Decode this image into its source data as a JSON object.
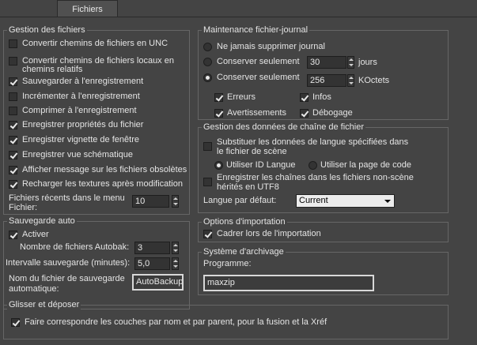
{
  "tab": {
    "label": "Fichiers"
  },
  "gestion": {
    "title": "Gestion des fichiers",
    "items": [
      {
        "label": "Convertir chemins de fichiers en UNC",
        "checked": false
      },
      {
        "label": "Convertir chemins de fichiers locaux en",
        "label2": "chemins relatifs",
        "checked": false
      },
      {
        "label": "Sauvegarder à l'enregistrement",
        "checked": true
      },
      {
        "label": "Incrémenter à l'enregistrement",
        "checked": false
      },
      {
        "label": "Comprimer à l'enregistrement",
        "checked": false
      },
      {
        "label": "Enregistrer propriétés du fichier",
        "checked": true
      },
      {
        "label": "Enregistrer vignette de fenêtre",
        "checked": true
      },
      {
        "label": "Enregistrer vue schématique",
        "checked": true
      },
      {
        "label": "Afficher message sur les fichiers obsolètes",
        "checked": true
      },
      {
        "label": "Recharger les textures après modification",
        "checked": true
      }
    ],
    "recent_label1": "Fichiers récents dans le menu",
    "recent_label2": "Fichier:",
    "recent_value": "10"
  },
  "sauvegarde": {
    "title": "Sauvegarde auto",
    "activer_label": "Activer",
    "activer_checked": true,
    "nombre_label": "Nombre de fichiers Autobak:",
    "nombre_value": "3",
    "intervalle_label": "Intervalle sauvegarde (minutes):",
    "intervalle_value": "5,0",
    "nom_label1": "Nom du fichier de sauvegarde",
    "nom_label2": "automatique:",
    "nom_value": "AutoBackup"
  },
  "maintenance": {
    "title": "Maintenance fichier-journal",
    "opt_never": "Ne jamais supprimer journal",
    "opt_days": "Conserver seulement",
    "days_value": "30",
    "days_unit": "jours",
    "opt_size": "Conserver seulement",
    "size_value": "256",
    "size_unit": "KOctets",
    "selected": "size",
    "erreurs": "Erreurs",
    "infos": "Infos",
    "avertissements": "Avertissements",
    "debogage": "Débogage"
  },
  "chaine": {
    "title": "Gestion des données de chaîne de fichier",
    "substituer_label1": "Substituer les données de langue spécifiées dans",
    "substituer_label2": "le fichier de scène",
    "opt_id": "Utiliser ID Langue",
    "opt_page": "Utiliser la page de code",
    "enregistrer_label1": "Enregistrer les chaînes dans les fichiers non-scène",
    "enregistrer_label2": "hérités en UTF8",
    "langue_label": "Langue par défaut:",
    "langue_value": "Current"
  },
  "importation": {
    "title": "Options d'importation",
    "cadrer_label": "Cadrer lors de l'importation"
  },
  "archivage": {
    "title": "Système d'archivage",
    "programme_label": "Programme:",
    "programme_value": "maxzip"
  },
  "glisser": {
    "title": "Glisser et déposer",
    "faire_label": "Faire correspondre les couches par nom et par parent, pour la fusion et la Xréf"
  }
}
